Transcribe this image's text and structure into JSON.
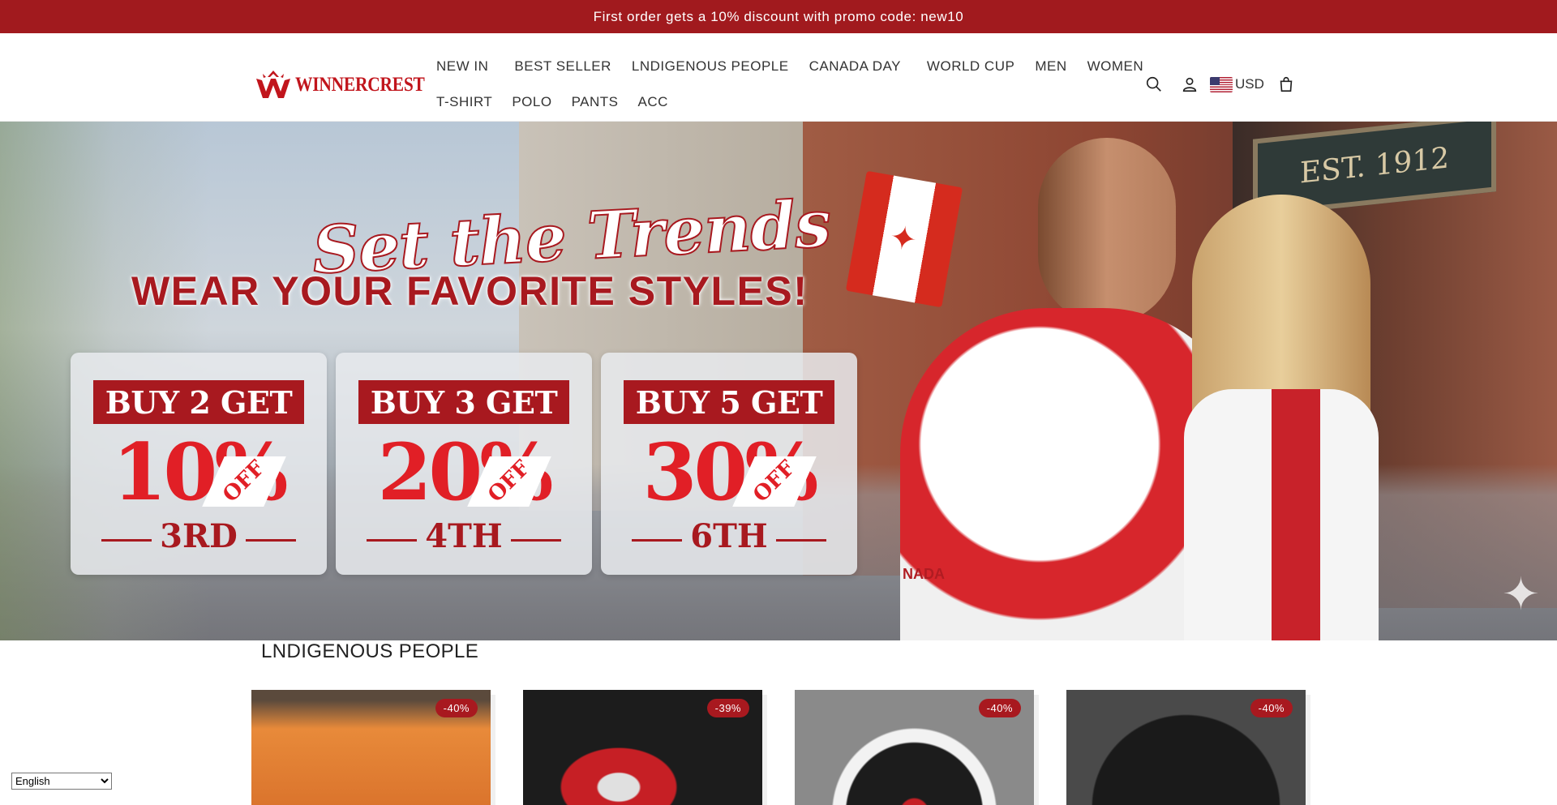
{
  "announcement": {
    "text": "First order gets a 10% discount with promo code: new10"
  },
  "brand": {
    "name": "WINNERCREST",
    "color": "#c1151c"
  },
  "nav": {
    "row1": [
      "NEW IN",
      "BEST SELLER",
      "LNDIGENOUS PEOPLE",
      "CANADA DAY",
      "WORLD CUP",
      "MEN",
      "WOMEN"
    ],
    "row2": [
      "T-SHIRT",
      "POLO",
      "PANTS",
      "ACC"
    ]
  },
  "header_icons": {
    "search": "search-icon",
    "account": "user-icon",
    "cart": "cart-icon",
    "currency": "USD"
  },
  "hero": {
    "script_text": "Set the Trends",
    "headline": "WEAR YOUR FAVORITE STYLES!",
    "sign_text": "EST. 1912",
    "shirt_text": "NADA",
    "promos": [
      {
        "title": "BUY 2 GET",
        "pct": "10%",
        "off": "OFF",
        "ord": "3RD"
      },
      {
        "title": "BUY 3 GET",
        "pct": "20%",
        "off": "OFF",
        "ord": "4TH"
      },
      {
        "title": "BUY 5 GET",
        "pct": "30%",
        "off": "OFF",
        "ord": "6TH"
      }
    ]
  },
  "section": {
    "title": "LNDIGENOUS PEOPLE",
    "products": [
      {
        "badge": "-40%",
        "color": "#e07a2a"
      },
      {
        "badge": "-39%",
        "color": "#1b1b1b"
      },
      {
        "badge": "-40%",
        "color": "#8e8e8e"
      },
      {
        "badge": "-40%",
        "color": "#3b3b3b"
      }
    ]
  },
  "language": {
    "selected": "English"
  },
  "colors": {
    "accent": "#a11a1e",
    "badge": "#a8191f"
  }
}
